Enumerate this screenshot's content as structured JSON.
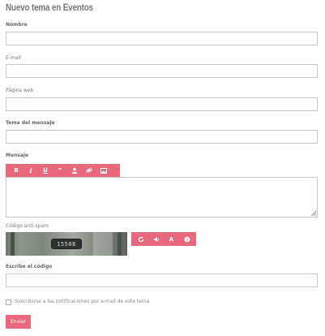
{
  "page": {
    "title": "Nuevo tema en Eventos"
  },
  "form": {
    "name_label": "Nombre",
    "email_label": "E-mail",
    "website_label": "Página web",
    "subject_label": "Tema del mensaje",
    "message_label": "Mensaje",
    "toolbar": [
      "bold-icon",
      "italic-icon",
      "underline-icon",
      "quote-icon",
      "user-icon",
      "link-icon",
      "image-icon"
    ],
    "toolbar_glyphs": {
      "bold": "B",
      "italic": "I",
      "underline": "U",
      "quote": "❞"
    },
    "captcha_label": "Código anti-spam",
    "captcha_image_text": "15508",
    "captcha_tools": [
      "refresh-icon",
      "audio-icon",
      "font-icon",
      "info-icon"
    ],
    "captcha_glyphs": {
      "font": "A"
    },
    "code_label": "Escribe el código",
    "subscribe_label": "Suscribirse a las notificaciones por e-mail de este tema",
    "submit_label": "Enviar"
  },
  "colors": {
    "accent": "#e8697d",
    "border": "#c8c8c8"
  }
}
